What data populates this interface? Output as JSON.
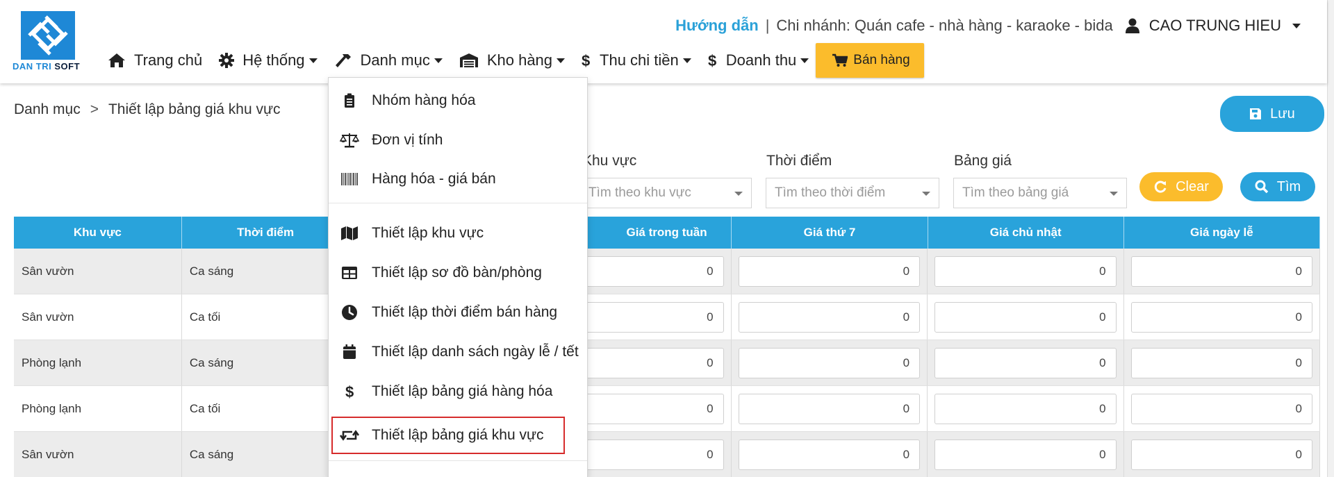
{
  "header": {
    "brand_part1": "DAN TRI",
    "brand_part2": "SOFT",
    "guide_link": "Hướng dẫn",
    "separator": "|",
    "branch": "Chi nhánh: Quán cafe - nhà hàng - karaoke - bida",
    "user_name": "CAO TRUNG HIEU"
  },
  "nav": {
    "home": "Trang chủ",
    "system": "Hệ thống",
    "catalog": "Danh mục",
    "warehouse": "Kho hàng",
    "cashflow": "Thu chi tiền",
    "revenue": "Doanh thu",
    "sell": "Bán hàng"
  },
  "breadcrumb": {
    "parent": "Danh mục",
    "separator": ">",
    "current": "Thiết lập bảng giá khu vực"
  },
  "actions": {
    "save": "Lưu",
    "clear": "Clear",
    "search": "Tìm"
  },
  "filters": {
    "area_label": "Khu vực",
    "area_placeholder": "Tìm theo khu vực",
    "time_label": "Thời điểm",
    "time_placeholder": "Tìm theo thời điểm",
    "pricelist_label": "Bảng giá",
    "pricelist_placeholder": "Tìm theo bảng giá"
  },
  "table": {
    "headers": [
      "Khu vực",
      "Thời điểm",
      "Giá trong tuần",
      "Giá thứ 7",
      "Giá chủ nhật",
      "Giá ngày lễ"
    ],
    "rows": [
      {
        "area": "Sân vườn",
        "time": "Ca sáng",
        "weekday": "0",
        "saturday": "0",
        "sunday": "0",
        "holiday": "0"
      },
      {
        "area": "Sân vườn",
        "time": "Ca tối",
        "weekday": "0",
        "saturday": "0",
        "sunday": "0",
        "holiday": "0"
      },
      {
        "area": "Phòng lạnh",
        "time": "Ca sáng",
        "weekday": "0",
        "saturday": "0",
        "sunday": "0",
        "holiday": "0"
      },
      {
        "area": "Phòng lạnh",
        "time": "Ca tối",
        "weekday": "0",
        "saturday": "0",
        "sunday": "0",
        "holiday": "0"
      },
      {
        "area": "Sân vườn",
        "time": "Ca sáng",
        "weekday": "0",
        "saturday": "0",
        "sunday": "0",
        "holiday": "0"
      }
    ]
  },
  "menu": {
    "items": [
      {
        "label": "Nhóm hàng hóa",
        "icon": "clipboard-icon"
      },
      {
        "label": "Đơn vị tính",
        "icon": "balance-scale-icon"
      },
      {
        "label": "Hàng hóa - giá bán",
        "icon": "barcode-icon"
      },
      {
        "label": "Thiết lập khu vực",
        "icon": "map-icon"
      },
      {
        "label": "Thiết lập sơ đồ bàn/phòng",
        "icon": "table-icon"
      },
      {
        "label": "Thiết lập thời điểm bán hàng",
        "icon": "clock-icon"
      },
      {
        "label": "Thiết lập danh sách ngày lễ / tết",
        "icon": "calendar-icon"
      },
      {
        "label": "Thiết lập bảng giá hàng hóa",
        "icon": "dollar-icon"
      },
      {
        "label": "Thiết lập bảng giá khu vực",
        "icon": "retweet-icon"
      }
    ]
  },
  "colors": {
    "primary": "#29a3db",
    "accent": "#fbbc2c",
    "highlight_border": "#d62b2b",
    "guide_link": "#2aa1d8"
  }
}
